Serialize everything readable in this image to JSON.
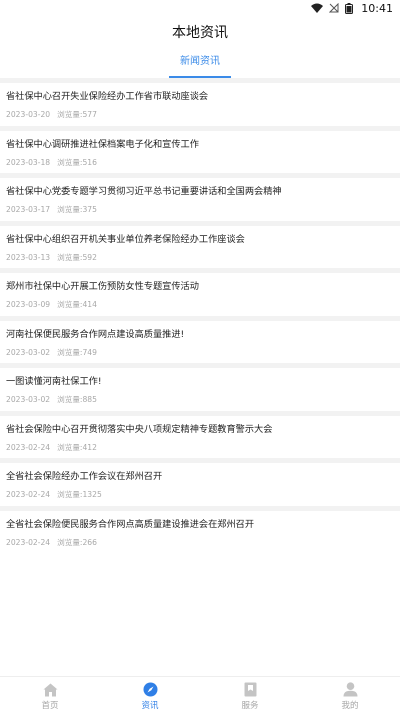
{
  "status_bar": {
    "time": "10:41"
  },
  "header": {
    "title": "本地资讯",
    "tabs": [
      {
        "label": "新闻资讯",
        "active": true
      }
    ]
  },
  "news": [
    {
      "title": "省社保中心召开失业保险经办工作省市联动座谈会",
      "date": "2023-03-20",
      "views": "浏览量:577"
    },
    {
      "title": "省社保中心调研推进社保档案电子化和宣传工作",
      "date": "2023-03-18",
      "views": "浏览量:516"
    },
    {
      "title": "省社保中心党委专题学习贯彻习近平总书记重要讲话和全国两会精神",
      "date": "2023-03-17",
      "views": "浏览量:375"
    },
    {
      "title": "省社保中心组织召开机关事业单位养老保险经办工作座谈会",
      "date": "2023-03-13",
      "views": "浏览量:592"
    },
    {
      "title": "郑州市社保中心开展工伤预防女性专题宣传活动",
      "date": "2023-03-09",
      "views": "浏览量:414"
    },
    {
      "title": "河南社保便民服务合作网点建设高质量推进!",
      "date": "2023-03-02",
      "views": "浏览量:749"
    },
    {
      "title": "一图读懂河南社保工作!",
      "date": "2023-03-02",
      "views": "浏览量:885"
    },
    {
      "title": "省社会保险中心召开贯彻落实中央八项规定精神专题教育警示大会",
      "date": "2023-02-24",
      "views": "浏览量:412"
    },
    {
      "title": "全省社会保险经办工作会议在郑州召开",
      "date": "2023-02-24",
      "views": "浏览量:1325"
    },
    {
      "title": "全省社会保险便民服务合作网点高质量建设推进会在郑州召开",
      "date": "2023-02-24",
      "views": "浏览量:266"
    }
  ],
  "bottom_nav": [
    {
      "label": "首页",
      "icon": "home-icon",
      "active": false
    },
    {
      "label": "资讯",
      "icon": "compass-icon",
      "active": true
    },
    {
      "label": "服务",
      "icon": "bookmark-icon",
      "active": false
    },
    {
      "label": "我的",
      "icon": "user-icon",
      "active": false
    }
  ],
  "colors": {
    "accent": "#3b8be8",
    "inactive": "#a6a6a6",
    "divider": "#f2f2f2"
  }
}
